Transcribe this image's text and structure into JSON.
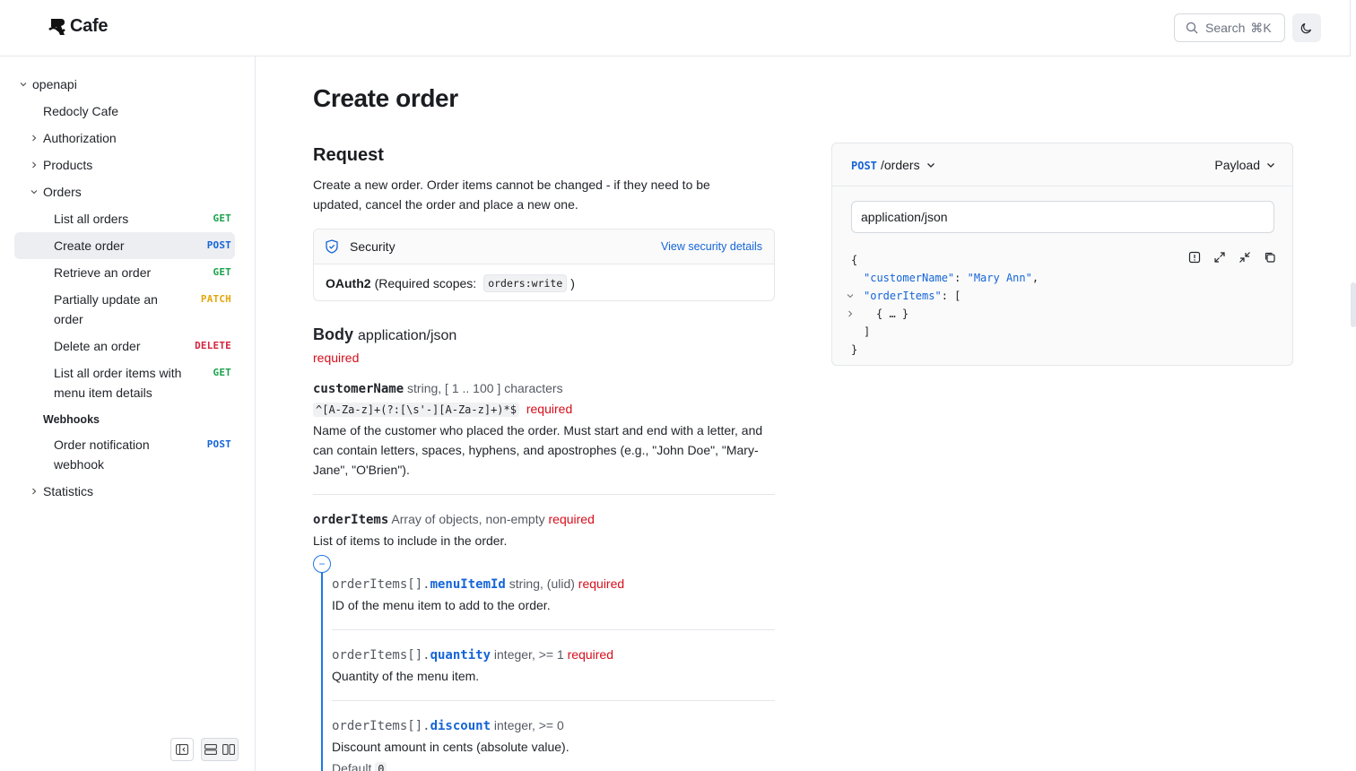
{
  "header": {
    "logo_text": "Cafe",
    "search_label": "Search",
    "search_shortcut": "⌘K"
  },
  "sidebar": {
    "root_label": "openapi",
    "items": [
      {
        "label": "Redocly Cafe"
      },
      {
        "label": "Authorization"
      },
      {
        "label": "Products"
      },
      {
        "label": "Orders"
      },
      {
        "label": "Webhooks"
      },
      {
        "label": "Statistics"
      }
    ],
    "operations": [
      {
        "label": "List all orders",
        "method": "GET"
      },
      {
        "label": "Create order",
        "method": "POST"
      },
      {
        "label": "Retrieve an order",
        "method": "GET"
      },
      {
        "label": "Partially update an order",
        "method": "PATCH"
      },
      {
        "label": "Delete an order",
        "method": "DELETE"
      },
      {
        "label": "List all order items with menu item details",
        "method": "GET"
      },
      {
        "label": "Order notification webhook",
        "method": "POST"
      }
    ]
  },
  "main": {
    "title": "Create order",
    "request_heading": "Request",
    "request_description": "Create a new order. Order items cannot be changed - if they need to be updated, cancel the order and place a new one.",
    "security": {
      "title": "Security",
      "link": "View security details",
      "scheme": "OAuth2",
      "scopes_label": "(Required scopes:",
      "scope": "orders:write",
      "close": ")"
    },
    "body_heading": "Body",
    "body_type": "application/json",
    "body_required": "required",
    "fields": [
      {
        "name": "customerName",
        "type": "string, [ 1 .. 100 ] characters",
        "pattern": "^[A-Za-z]+(?:[\\s'-][A-Za-z]+)*$",
        "required": "required",
        "description": "Name of the customer who placed the order. Must start and end with a letter, and can contain letters, spaces, hyphens, and apostrophes (e.g., \"John Doe\", \"Mary-Jane\", \"O'Brien\")."
      },
      {
        "name": "orderItems",
        "type": "Array of objects, non-empty",
        "required": "required",
        "description": "List of items to include in the order."
      }
    ],
    "nested": [
      {
        "prefix": "orderItems[].",
        "name": "menuItemId",
        "type": "string, (ulid)",
        "required": "required",
        "description": "ID of the menu item to add to the order."
      },
      {
        "prefix": "orderItems[].",
        "name": "quantity",
        "type": "integer, >= 1",
        "required": "required",
        "description": "Quantity of the menu item."
      },
      {
        "prefix": "orderItems[].",
        "name": "discount",
        "type": "integer, >= 0",
        "required": "",
        "description": "Discount amount in cents (absolute value).",
        "default_label": "Default",
        "default_value": "0"
      }
    ]
  },
  "panel": {
    "method": "POST",
    "path": "/orders",
    "payload_label": "Payload",
    "content_type": "application/json",
    "code": {
      "open": "{",
      "key1": "\"customerName\"",
      "val1": "\"Mary Ann\"",
      "key2": "\"orderItems\"",
      "arr_open": "[",
      "collapsed": "{ … }",
      "arr_close": "]",
      "close": "}"
    }
  },
  "colors": {
    "get": "#1aa24b",
    "post": "#1565d8",
    "patch": "#e3a70b",
    "delete": "#d3253f",
    "required": "#d60e1b"
  }
}
